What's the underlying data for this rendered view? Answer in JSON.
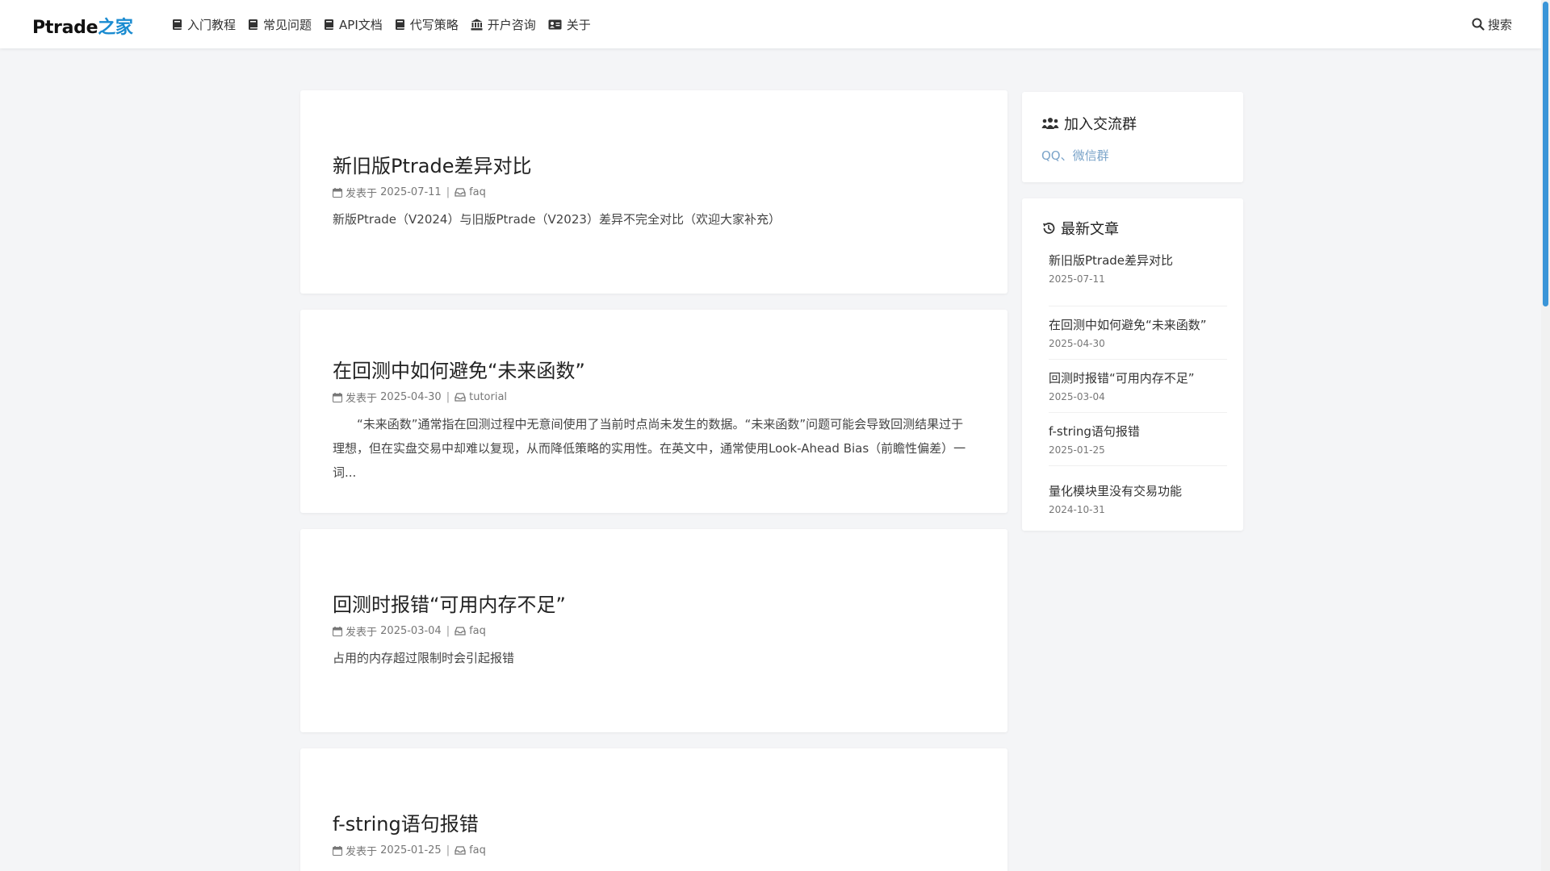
{
  "header": {
    "logo_main": "Ptrade",
    "logo_accent": "之家",
    "nav": [
      {
        "label": "入门教程",
        "icon": "book-icon"
      },
      {
        "label": "常见问题",
        "icon": "book-icon"
      },
      {
        "label": "API文档",
        "icon": "book-icon"
      },
      {
        "label": "代写策略",
        "icon": "book-icon"
      },
      {
        "label": "开户咨询",
        "icon": "bank-icon"
      },
      {
        "label": "关于",
        "icon": "id-card-icon"
      }
    ],
    "search_label": "搜索"
  },
  "posts": [
    {
      "title": "新旧版Ptrade差异对比",
      "meta_prefix": "发表于",
      "date": "2025-07-11",
      "category": "faq",
      "excerpt": "新版Ptrade（V2024）与旧版Ptrade（V2023）差异不完全对比（欢迎大家补充）"
    },
    {
      "title": "在回测中如何避免“未来函数”",
      "meta_prefix": "发表于",
      "date": "2025-04-30",
      "category": "tutorial",
      "excerpt": "“未来函数”通常指在回测过程中无意间使用了当前时点尚未发生的数据。“未来函数”问题可能会导致回测结果过于理想，但在实盘交易中却难以复现，从而降低策略的实用性。在英文中，通常使用Look-Ahead Bias（前瞻性偏差）一词..."
    },
    {
      "title": "回测时报错“可用内存不足”",
      "meta_prefix": "发表于",
      "date": "2025-03-04",
      "category": "faq",
      "excerpt": "占用的内存超过限制时会引起报错"
    },
    {
      "title": "f-string语句报错",
      "meta_prefix": "发表于",
      "date": "2025-01-25",
      "category": "faq",
      "excerpt": ""
    }
  ],
  "sidebar": {
    "join": {
      "title": "加入交流群",
      "link": "QQ、微信群"
    },
    "recent": {
      "title": "最新文章",
      "items": [
        {
          "title": "新旧版Ptrade差异对比",
          "date": "2025-07-11"
        },
        {
          "title": "在回测中如何避免“未来函数”",
          "date": "2025-04-30"
        },
        {
          "title": "回测时报错“可用内存不足”",
          "date": "2025-03-04"
        },
        {
          "title": "f-string语句报错",
          "date": "2025-01-25"
        },
        {
          "title": "量化模块里没有交易功能",
          "date": "2024-10-31"
        }
      ]
    }
  },
  "colors": {
    "accent": "#1a8bd0",
    "link": "#7ba4c9",
    "scrollbar": "#3a95d8"
  }
}
